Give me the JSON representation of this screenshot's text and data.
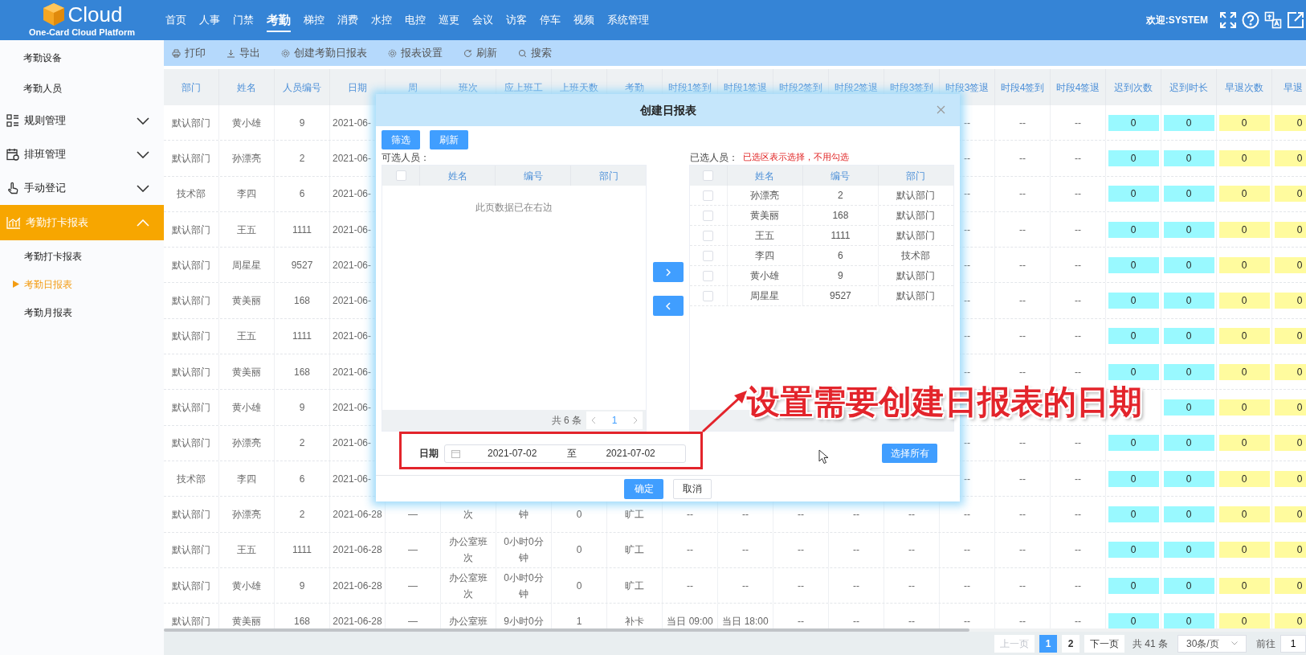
{
  "header": {
    "logo": {
      "name": "Cloud",
      "subtitle": "One-Card Cloud Platform"
    },
    "nav": [
      {
        "label": "首页",
        "selected": false
      },
      {
        "label": "人事",
        "selected": false
      },
      {
        "label": "门禁",
        "selected": false
      },
      {
        "label": "考勤",
        "selected": true
      },
      {
        "label": "梯控",
        "selected": false
      },
      {
        "label": "消费",
        "selected": false
      },
      {
        "label": "水控",
        "selected": false
      },
      {
        "label": "电控",
        "selected": false
      },
      {
        "label": "巡更",
        "selected": false
      },
      {
        "label": "会议",
        "selected": false
      },
      {
        "label": "访客",
        "selected": false
      },
      {
        "label": "停车",
        "selected": false
      },
      {
        "label": "视频",
        "selected": false
      },
      {
        "label": "系统管理",
        "selected": false
      }
    ],
    "welcome": "欢迎:SYSTEM"
  },
  "sidebar": {
    "items": [
      {
        "label": "考勤设备",
        "kind": "link"
      },
      {
        "label": "考勤人员",
        "kind": "link"
      },
      {
        "label": "规则管理",
        "kind": "group",
        "expanded": false
      },
      {
        "label": "排班管理",
        "kind": "group",
        "expanded": false
      },
      {
        "label": "手动登记",
        "kind": "group",
        "expanded": false
      },
      {
        "label": "考勤打卡报表",
        "kind": "group",
        "expanded": true,
        "children": [
          {
            "label": "考勤打卡报表",
            "selected": false
          },
          {
            "label": "考勤日报表",
            "selected": true
          },
          {
            "label": "考勤月报表",
            "selected": false
          }
        ]
      }
    ]
  },
  "toolbar": [
    "打印",
    "导出",
    "创建考勤日报表",
    "报表设置",
    "刷新",
    "搜索"
  ],
  "table": {
    "columns": [
      {
        "label": "部门",
        "kind": "plain"
      },
      {
        "label": "姓名",
        "kind": "plain"
      },
      {
        "label": "人员编号",
        "kind": "plain"
      },
      {
        "label": "日期",
        "kind": "plain"
      },
      {
        "label": "周",
        "kind": "plain"
      },
      {
        "label": "班次",
        "kind": "plain"
      },
      {
        "label": "应上班工",
        "kind": "plain"
      },
      {
        "label": "上班天数",
        "kind": "plain"
      },
      {
        "label": "考勤",
        "kind": "plain"
      },
      {
        "label": "时段1签到",
        "kind": "plain"
      },
      {
        "label": "时段1签退",
        "kind": "plain"
      },
      {
        "label": "时段2签到",
        "kind": "plain"
      },
      {
        "label": "时段2签退",
        "kind": "plain"
      },
      {
        "label": "时段3签到",
        "kind": "plain"
      },
      {
        "label": "时段3签退",
        "kind": "plain"
      },
      {
        "label": "时段4签到",
        "kind": "plain"
      },
      {
        "label": "时段4签退",
        "kind": "plain"
      },
      {
        "label": "迟到次数",
        "kind": "late"
      },
      {
        "label": "迟到时长",
        "kind": "late"
      },
      {
        "label": "早退次数",
        "kind": "early"
      },
      {
        "label": "早退",
        "kind": "early"
      }
    ],
    "rows": [
      {
        "lead": [
          "默认部门",
          "黄小雄",
          "9",
          "2021-06-"
        ],
        "tail": [
          "--",
          "--",
          "--",
          "0",
          "0",
          "0",
          "0"
        ]
      },
      {
        "lead": [
          "默认部门",
          "孙漂亮",
          "2",
          "2021-06-"
        ],
        "tail": [
          "--",
          "--",
          "--",
          "0",
          "0",
          "0",
          "0"
        ]
      },
      {
        "lead": [
          "技术部",
          "李四",
          "6",
          "2021-06-"
        ],
        "tail": [
          "--",
          "--",
          "--",
          "0",
          "0",
          "0",
          "0"
        ]
      },
      {
        "lead": [
          "默认部门",
          "王五",
          "1111",
          "2021-06-"
        ],
        "tail": [
          "--",
          "--",
          "--",
          "0",
          "0",
          "0",
          "0"
        ]
      },
      {
        "lead": [
          "默认部门",
          "周星星",
          "9527",
          "2021-06-"
        ],
        "tail": [
          "--",
          "--",
          "--",
          "0",
          "0",
          "0",
          "0"
        ]
      },
      {
        "lead": [
          "默认部门",
          "黄美丽",
          "168",
          "2021-06-"
        ],
        "tail": [
          "--",
          "--",
          "--",
          "0",
          "0",
          "0",
          "0"
        ]
      },
      {
        "lead": [
          "默认部门",
          "王五",
          "1111",
          "2021-06-"
        ],
        "tail": [
          "--",
          "--",
          "--",
          "0",
          "0",
          "0",
          "0"
        ]
      },
      {
        "lead": [
          "默认部门",
          "黄美丽",
          "168",
          "2021-06-"
        ],
        "tail": [
          "--",
          "--",
          "--",
          "0",
          "0",
          "0",
          "0"
        ]
      },
      {
        "lead": [
          "默认部门",
          "黄小雄",
          "9",
          "2021-06-"
        ],
        "tail": [
          "0",
          "0",
          "0"
        ]
      },
      {
        "lead": [
          "默认部门",
          "孙漂亮",
          "2",
          "2021-06-"
        ],
        "tail": [
          "--",
          "--",
          "--",
          "0",
          "0",
          "0",
          "0"
        ]
      },
      {
        "lead": [
          "技术部",
          "李四",
          "6",
          "2021-06-"
        ],
        "tail": [
          "--",
          "--",
          "--",
          "0",
          "0",
          "0",
          "0"
        ]
      },
      {
        "lead": [
          "默认部门",
          "孙漂亮",
          "2",
          "2021-06-28"
        ],
        "middle": [
          "—",
          "次",
          "钟",
          "0",
          "旷工",
          "--",
          "--",
          "--",
          "--",
          "--"
        ],
        "tail": [
          "--",
          "--",
          "--",
          "0",
          "0",
          "0",
          "0"
        ]
      },
      {
        "lead": [
          "默认部门",
          "王五",
          "1111",
          "2021-06-28"
        ],
        "middle": [
          "—",
          "办公室班次",
          "0小时0分钟",
          "0",
          "旷工",
          "--",
          "--",
          "--",
          "--",
          "--"
        ],
        "tail": [
          "--",
          "--",
          "--",
          "0",
          "0",
          "0",
          "0"
        ]
      },
      {
        "lead": [
          "默认部门",
          "黄小雄",
          "9",
          "2021-06-28"
        ],
        "middle": [
          "—",
          "办公室班次",
          "0小时0分钟",
          "0",
          "旷工",
          "--",
          "--",
          "--",
          "--",
          "--"
        ],
        "tail": [
          "--",
          "--",
          "--",
          "0",
          "0",
          "0",
          "0"
        ]
      },
      {
        "lead": [
          "默认部门",
          "黄美丽",
          "168",
          "2021-06-28"
        ],
        "middle": [
          "—",
          "办公室班",
          "9小时0分",
          "1",
          "补卡",
          "当日 09:00",
          "当日 18:00",
          "--",
          "--",
          "--"
        ],
        "tail": [
          "--",
          "--",
          "--",
          "0",
          "0",
          "0",
          "0"
        ]
      }
    ]
  },
  "pagination": {
    "prev": {
      "label": "上一页",
      "disabled": true
    },
    "pages": [
      {
        "label": "1",
        "selected": true
      },
      {
        "label": "2",
        "selected": false
      }
    ],
    "next": {
      "label": "下一页",
      "disabled": false
    },
    "total": "共 41 条",
    "page_size": "30条/页",
    "goto_label": "前往",
    "goto_value": "1"
  },
  "modal": {
    "title": "创建日报表",
    "buttons": [
      "筛选",
      "刷新"
    ],
    "available": {
      "label": "可选人员：",
      "all_checked": false,
      "columns": [
        "姓名",
        "编号",
        "部门"
      ],
      "empty_text": "此页数据已在右边",
      "total": "共 6 条",
      "page": "1"
    },
    "selected": {
      "label": "已选人员：",
      "hint": "已选区表示选择，不用勾选",
      "all_checked": false,
      "columns": [
        "姓名",
        "编号",
        "部门"
      ],
      "rows": [
        {
          "name": "孙漂亮",
          "id": "2",
          "dept": "默认部门",
          "checked": false
        },
        {
          "name": "黄美丽",
          "id": "168",
          "dept": "默认部门",
          "checked": false
        },
        {
          "name": "王五",
          "id": "1111",
          "dept": "默认部门",
          "checked": false
        },
        {
          "name": "李四",
          "id": "6",
          "dept": "技术部",
          "checked": false
        },
        {
          "name": "黄小雄",
          "id": "9",
          "dept": "默认部门",
          "checked": false
        },
        {
          "name": "周星星",
          "id": "9527",
          "dept": "默认部门",
          "checked": false
        }
      ]
    },
    "date": {
      "label": "日期",
      "start": "2021-07-02",
      "separator": "至",
      "end": "2021-07-02"
    },
    "select_all": "选择所有",
    "ok": "确定",
    "cancel": "取消"
  },
  "annotation": {
    "text": "设置需要创建日报表的日期"
  }
}
